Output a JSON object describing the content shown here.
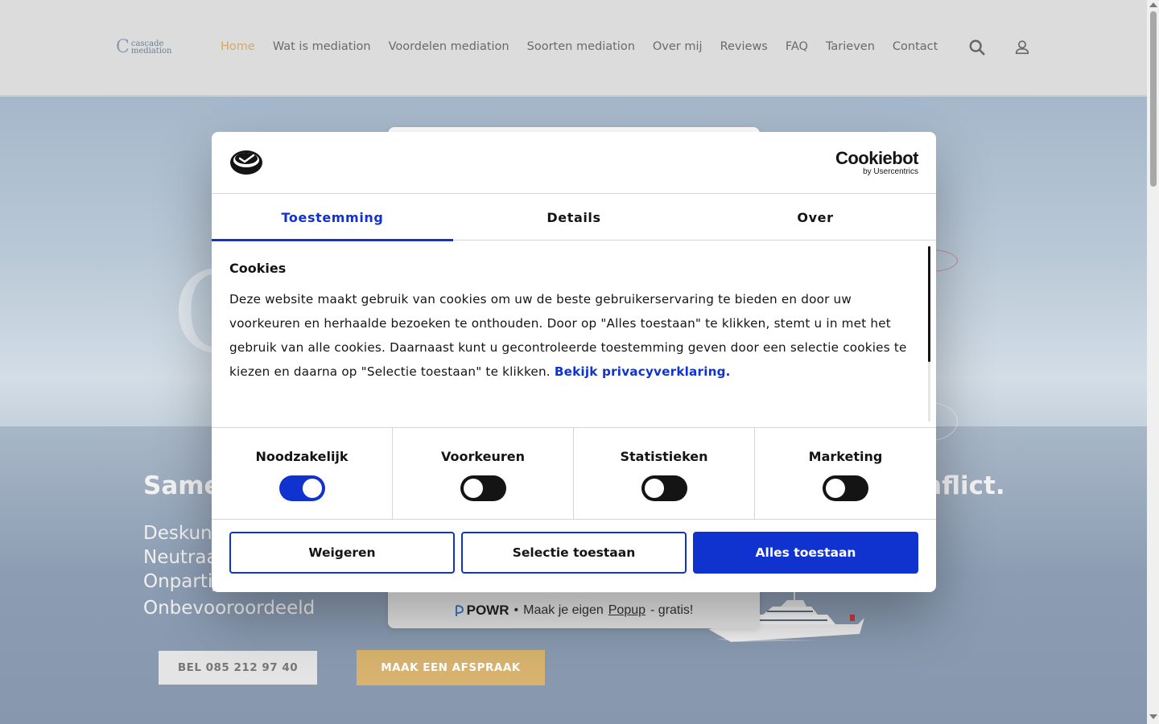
{
  "header": {
    "logo": {
      "mark": "C",
      "line1": "cascade",
      "line2": "mediation"
    },
    "nav": [
      {
        "label": "Home",
        "active": true
      },
      {
        "label": "Wat is mediation"
      },
      {
        "label": "Voordelen mediation"
      },
      {
        "label": "Soorten mediation"
      },
      {
        "label": "Over mij"
      },
      {
        "label": "Reviews"
      },
      {
        "label": "FAQ"
      },
      {
        "label": "Tarieven"
      },
      {
        "label": "Contact"
      }
    ],
    "icons": [
      "search-icon",
      "user-icon"
    ]
  },
  "hero": {
    "title_start": "Same",
    "title_end": "nflict.",
    "lines": [
      "Deskun",
      "Neutraa",
      "Onpartijdig",
      "Onbevooroordeeld"
    ],
    "ghost_logo": "C",
    "call_button": "BEL 085 212 97 40",
    "appointment_button": "MAAK EEN AFSPRAAK"
  },
  "powr": {
    "brand": "POWR",
    "separator": "•",
    "text_before": "Maak je eigen",
    "link": "Popup",
    "text_after": "- gratis!"
  },
  "cookie_dialog": {
    "brand_main": "Cookiebot",
    "brand_sub": "by Usercentrics",
    "tabs": [
      {
        "label": "Toestemming",
        "active": true
      },
      {
        "label": "Details"
      },
      {
        "label": "Over"
      }
    ],
    "title": "Cookies",
    "text": "Deze website maakt gebruik van cookies om uw de beste gebruikerservaring te bieden en door uw voorkeuren en herhaalde bezoeken te onthouden. Door op \"Alles toestaan\" te klikken, stemt u in met het gebruik van alle cookies. Daarnaast kunt u gecontroleerde toestemming geven door een selectie cookies te kiezen en daarna op \"Selectie toestaan\" te klikken.",
    "link": "Bekijk privacyverklaring.",
    "toggles": [
      {
        "label": "Noodzakelijk",
        "on": true
      },
      {
        "label": "Voorkeuren",
        "on": false
      },
      {
        "label": "Statistieken",
        "on": false
      },
      {
        "label": "Marketing",
        "on": false
      }
    ],
    "buttons": {
      "deny": "Weigeren",
      "selection": "Selectie toestaan",
      "allow_all": "Alles toestaan"
    },
    "colors": {
      "accent": "#1032cf",
      "text": "#141414"
    }
  },
  "colors": {
    "nav_active": "#d3a964",
    "appointment_button": "#d8b36f"
  }
}
